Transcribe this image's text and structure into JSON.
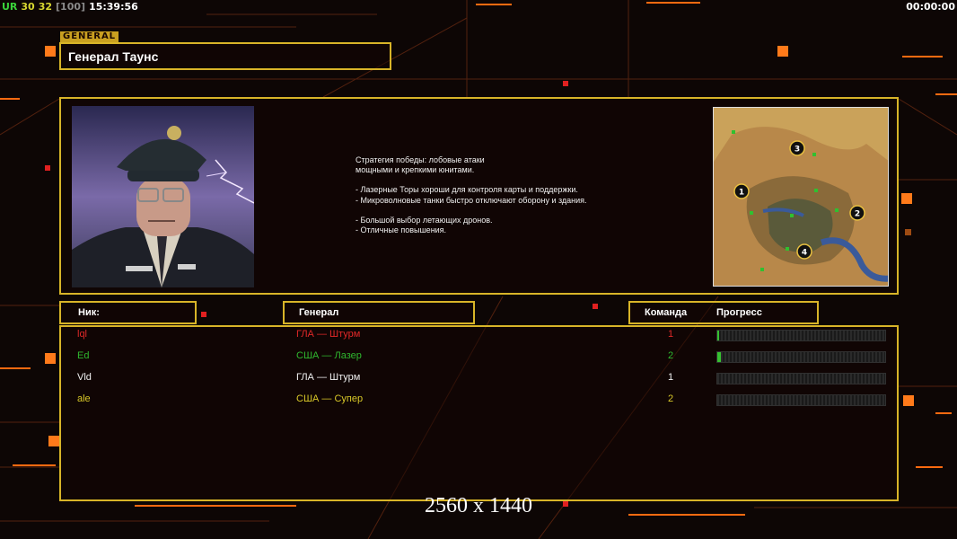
{
  "hud": {
    "ur": "UR",
    "a": "30",
    "b": "32",
    "c": "[100]",
    "clock": "15:39:56",
    "timer": "00:00:00"
  },
  "general_tag": "GENERAL",
  "general_name": "Генерал Таунс",
  "description": [
    "Стратегия победы: лобовые атаки",
    "мощными и крепкими юнитами.",
    "",
    "- Лазерные Торы хороши для контроля карты и поддержки.",
    "- Микроволновые танки быстро отключают оборону и здания.",
    "",
    "- Большой выбор летающих дронов.",
    "- Отличные повышения."
  ],
  "map_markers": [
    "1",
    "2",
    "3",
    "4"
  ],
  "headers": {
    "nick": "Ник:",
    "general": "Генерал",
    "team": "Команда",
    "progress": "Прогресс"
  },
  "players": [
    {
      "name": "lql",
      "general": "ГЛА — Штурм",
      "team": "1",
      "color": "#e02828",
      "progress": 0.01
    },
    {
      "name": "Ed",
      "general": "США — Лазер",
      "team": "2",
      "color": "#2fb82f",
      "progress": 0.02
    },
    {
      "name": "Vld",
      "general": "ГЛА — Штурм",
      "team": "1",
      "color": "#f0f0f0",
      "progress": 0
    },
    {
      "name": "ale",
      "general": "США — Супер",
      "team": "2",
      "color": "#d8c828",
      "progress": 0
    }
  ],
  "resolution": "2560 x 1440",
  "colors": {
    "accent": "#d8b428",
    "orange": "#ff7a1a",
    "background": "#0d0605"
  }
}
